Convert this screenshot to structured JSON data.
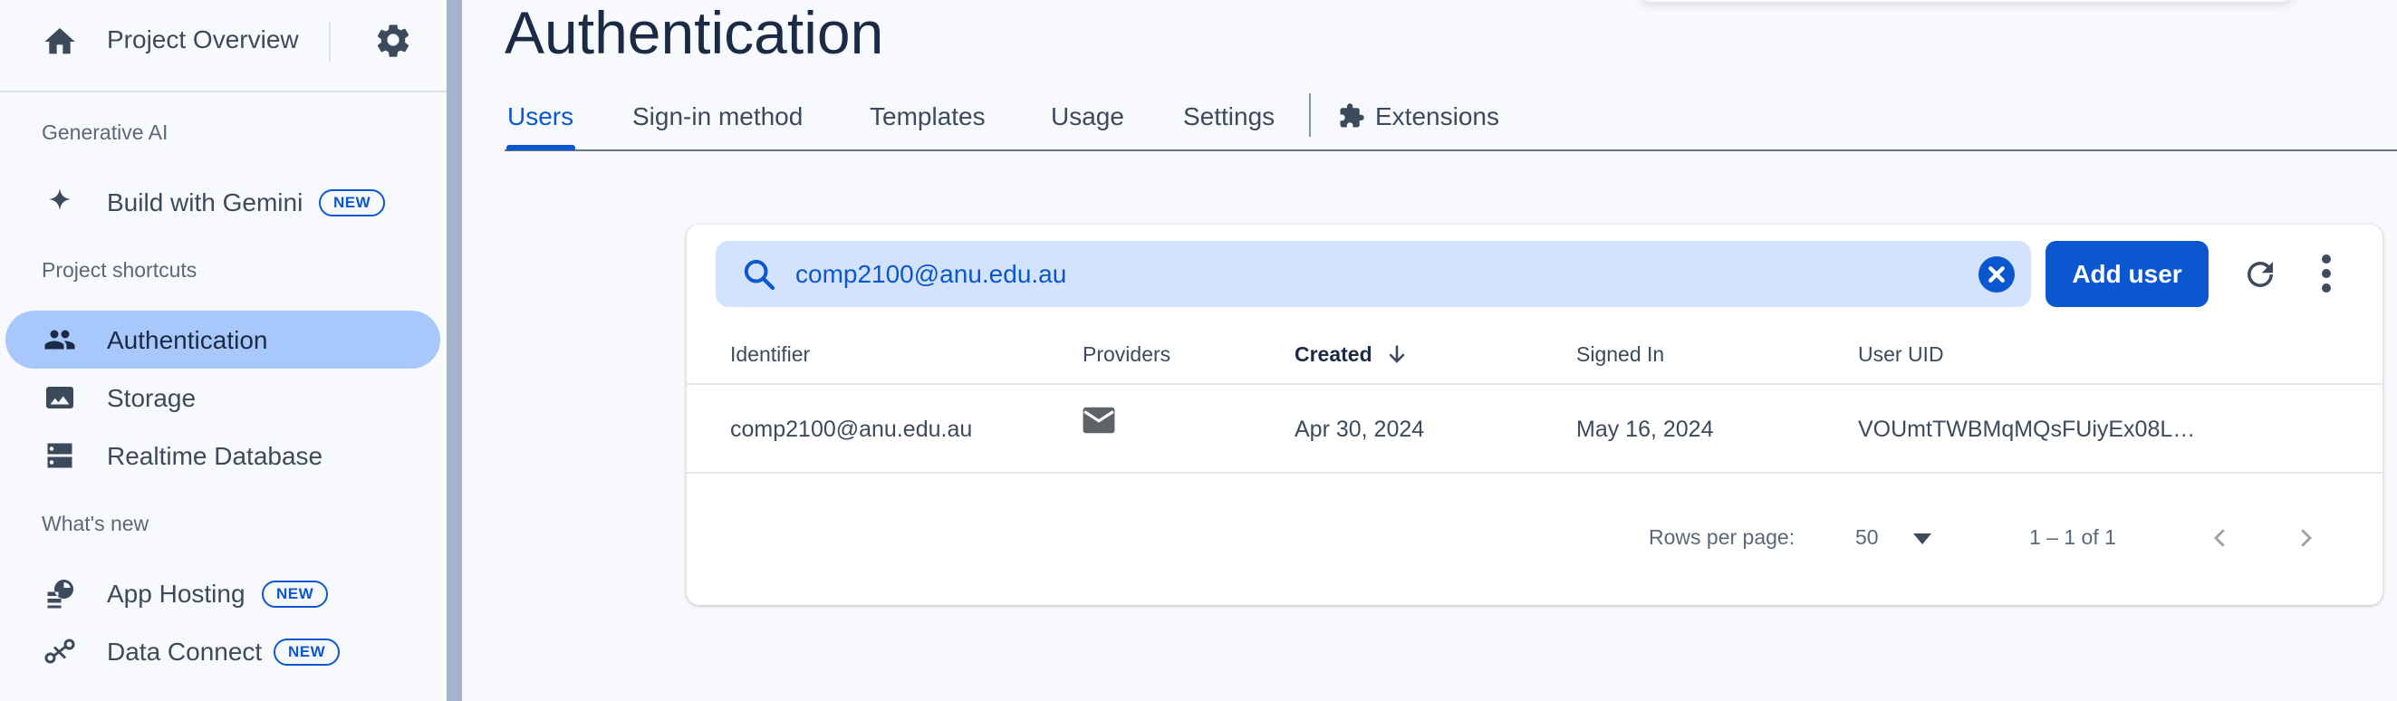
{
  "sidebar": {
    "project": {
      "label": "Project Overview",
      "home_icon": "home-icon",
      "settings_icon": "gear-icon"
    },
    "sections": {
      "generative_ai": "Generative AI",
      "project_shortcuts": "Project shortcuts",
      "whats_new": "What's new"
    },
    "items": [
      {
        "label": "Build with Gemini",
        "icon": "sparkle-icon",
        "badge": "NEW"
      },
      {
        "label": "Authentication",
        "icon": "people-icon",
        "active": true
      },
      {
        "label": "Storage",
        "icon": "image-icon"
      },
      {
        "label": "Realtime Database",
        "icon": "database-icon"
      },
      {
        "label": "App Hosting",
        "icon": "hosting-icon",
        "badge": "NEW"
      },
      {
        "label": "Data Connect",
        "icon": "data-connect-icon",
        "badge": "NEW"
      }
    ]
  },
  "page": {
    "title": "Authentication"
  },
  "tabs": [
    {
      "label": "Users",
      "active": true
    },
    {
      "label": "Sign-in method"
    },
    {
      "label": "Templates"
    },
    {
      "label": "Usage"
    },
    {
      "label": "Settings"
    },
    {
      "label": "Extensions",
      "icon": "puzzle-icon"
    }
  ],
  "search": {
    "value": "comp2100@anu.edu.au"
  },
  "toolbar": {
    "add_user_label": "Add user"
  },
  "table": {
    "columns": [
      "Identifier",
      "Providers",
      "Created",
      "Signed In",
      "User UID"
    ],
    "sorted_column": "Created",
    "rows": [
      {
        "identifier": "comp2100@anu.edu.au",
        "provider_icon": "email-icon",
        "created": "Apr 30, 2024",
        "signed_in": "May 16, 2024",
        "uid": "VOUmtTWBMqMQsFUiyEx08L…"
      }
    ]
  },
  "pagination": {
    "rows_per_page_label": "Rows per page:",
    "rows_per_page": "50",
    "range": "1 – 1 of 1"
  },
  "colors": {
    "accent": "#0b57d0",
    "active_nav": "#a8c7fa",
    "search_bg": "#d3e3fd",
    "page_bg": "#f8f9fd",
    "divider": "#a3b3c9"
  }
}
